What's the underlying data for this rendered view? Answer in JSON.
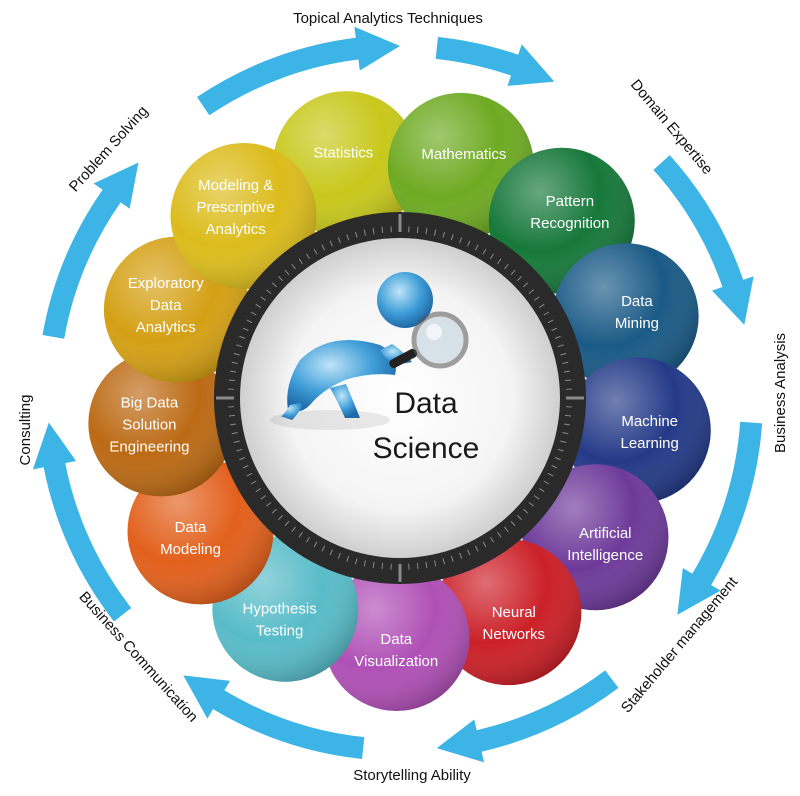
{
  "center": {
    "title_line1": "Data",
    "title_line2": "Science",
    "figure_icon": "person-with-magnifier-icon"
  },
  "segments": [
    {
      "lines": [
        "Statistics"
      ],
      "color": "#c8c81c"
    },
    {
      "lines": [
        "Mathematics"
      ],
      "color": "#6eaa22"
    },
    {
      "lines": [
        "Pattern",
        "Recognition"
      ],
      "color": "#16783a"
    },
    {
      "lines": [
        "Data",
        "Mining"
      ],
      "color": "#1a5a86"
    },
    {
      "lines": [
        "Machine",
        "Learning"
      ],
      "color": "#243a88"
    },
    {
      "lines": [
        "Artificial",
        "Intelligence"
      ],
      "color": "#6e3a9a"
    },
    {
      "lines": [
        "Neural",
        "Networks"
      ],
      "color": "#cc2028"
    },
    {
      "lines": [
        "Data",
        "Visualization"
      ],
      "color": "#b050b6"
    },
    {
      "lines": [
        "Hypothesis",
        "Testing"
      ],
      "color": "#58bcc8"
    },
    {
      "lines": [
        "Data",
        "Modeling"
      ],
      "color": "#e2601c"
    },
    {
      "lines": [
        "Big Data",
        "Solution",
        "Engineering"
      ],
      "color": "#bc6a14"
    },
    {
      "lines": [
        "Exploratory",
        "Data",
        "Analytics"
      ],
      "color": "#d4a014"
    },
    {
      "lines": [
        "Modeling &",
        "Prescriptive",
        "Analytics"
      ],
      "color": "#dcbc1c"
    }
  ],
  "outer_labels": [
    {
      "text": "Topical Analytics Techniques"
    },
    {
      "text": "Domain  Expertise"
    },
    {
      "text": "Business  Analysis"
    },
    {
      "text": "Stakeholder management"
    },
    {
      "text": "Storytelling  Ability"
    },
    {
      "text": "Business  Communication"
    },
    {
      "text": "Consulting"
    },
    {
      "text": "Problem Solving"
    }
  ],
  "arrow_color": "#3cb4e6",
  "ring_color": "#2a2a2a"
}
